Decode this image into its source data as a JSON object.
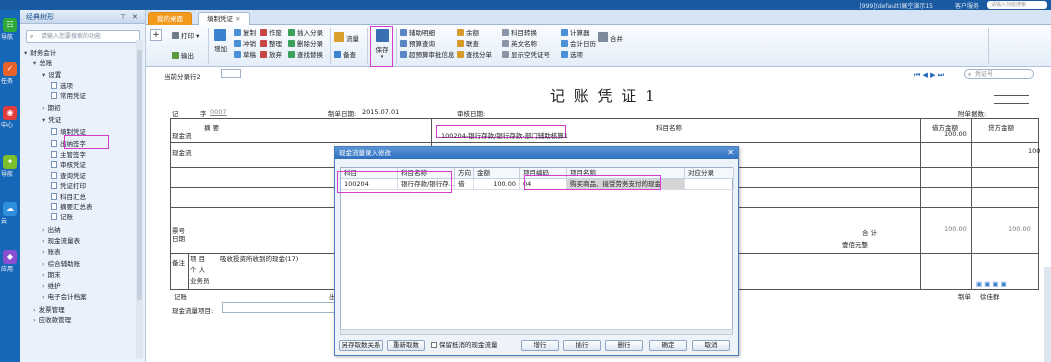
{
  "topbar": {
    "system": "[999](default)展空演示15",
    "service": "客户服务",
    "search_placeholder": "请输入功能搜索"
  },
  "rail": [
    "导航",
    "任务",
    "中心",
    "导航",
    "云",
    "应用"
  ],
  "left_panel": {
    "title": "经典树形",
    "search_placeholder": "请输入您要搜索的功能",
    "tree": [
      {
        "label": "财务会计",
        "level": 0,
        "arrow": "▾"
      },
      {
        "label": "总账",
        "level": 1,
        "arrow": "▾"
      },
      {
        "label": "设置",
        "level": 2,
        "arrow": "▾"
      },
      {
        "label": "选项",
        "level": 3,
        "arrow": ""
      },
      {
        "label": "常用凭证",
        "level": 3,
        "arrow": ""
      },
      {
        "label": "期初",
        "level": 2,
        "arrow": "›"
      },
      {
        "label": "凭证",
        "level": 2,
        "arrow": "▾"
      },
      {
        "label": "填制凭证",
        "level": 3,
        "arrow": ""
      },
      {
        "label": "出纳签字",
        "level": 3,
        "arrow": ""
      },
      {
        "label": "主管签字",
        "level": 3,
        "arrow": ""
      },
      {
        "label": "审核凭证",
        "level": 3,
        "arrow": ""
      },
      {
        "label": "查询凭证",
        "level": 3,
        "arrow": ""
      },
      {
        "label": "凭证打印",
        "level": 3,
        "arrow": ""
      },
      {
        "label": "科目汇总",
        "level": 3,
        "arrow": ""
      },
      {
        "label": "摘要汇总表",
        "level": 3,
        "arrow": ""
      },
      {
        "label": "记账",
        "level": 3,
        "arrow": ""
      },
      {
        "label": "出纳",
        "level": 2,
        "arrow": "›"
      },
      {
        "label": "现金流量表",
        "level": 2,
        "arrow": "›"
      },
      {
        "label": "账表",
        "level": 2,
        "arrow": "›"
      },
      {
        "label": "综合辅助账",
        "level": 2,
        "arrow": "›"
      },
      {
        "label": "期末",
        "level": 2,
        "arrow": "›"
      },
      {
        "label": "维护",
        "level": 2,
        "arrow": "›"
      },
      {
        "label": "电子会计档案",
        "level": 2,
        "arrow": "›"
      },
      {
        "label": "发票管理",
        "level": 1,
        "arrow": "›"
      },
      {
        "label": "应收款管理",
        "level": 1,
        "arrow": "›"
      }
    ]
  },
  "tabs": [
    {
      "label": "我的桌面"
    },
    {
      "label": "填制凭证"
    }
  ],
  "ribbon": {
    "print": "打印",
    "export": "输出",
    "add": "增加",
    "group1": [
      "复制",
      "冲销",
      "草稿"
    ],
    "group2": [
      "作废",
      "整理",
      "放弃"
    ],
    "group3": [
      "插入分录",
      "删除分录",
      "查找替换"
    ],
    "flow": "流量",
    "memo": "备查",
    "save": "保存",
    "group4": [
      "辅助明细",
      "预算查询",
      "超预算审批信息"
    ],
    "group5": [
      "余额",
      "联查",
      "查找分单"
    ],
    "group6": [
      "科目转换",
      "英文名称",
      "显示空凭证号"
    ],
    "group7": [
      "计算器",
      "会计日历",
      "选项"
    ],
    "merge": "合并"
  },
  "form": {
    "entry_row_label": "当前分录行2",
    "voucher_title": "记 账 凭 证 1",
    "voucher_type": "记",
    "voucher_no_label": "字",
    "voucher_no": "0007",
    "date_label": "制单日期:",
    "date": "2015.07.01",
    "audit_label": "审核日期:",
    "attach_label": "附单据数:",
    "nav_search": "凭证号",
    "col_summary": "摘 要",
    "col_account": "科目名称",
    "col_debit": "借方金额",
    "col_credit": "贷方金额",
    "rows": [
      {
        "summary": "现金流",
        "account": "100204-银行存款/银行存款-部门辅助核算1",
        "debit": "100.00",
        "credit": ""
      },
      {
        "summary": "现金流",
        "account": "",
        "debit": "",
        "credit": "100"
      }
    ],
    "ticket_label": "票号",
    "date2_label": "日期",
    "total_label": "合 计",
    "total_debit": "100.00",
    "total_credit": "100.00",
    "amount_words": "壹佰元整",
    "note_label": "备注",
    "note_items": [
      "项 目",
      "个 人",
      "业务员"
    ],
    "note_value": "吸收投资所收到的现金(17)",
    "bookkeeper_label": "记账",
    "cashier_label": "出",
    "maker_label": "制单",
    "maker": "徐佳群",
    "cash_item_label": "现金流量项目:"
  },
  "dialog": {
    "title": "现金流量录入修改",
    "columns": [
      "科目",
      "科目名称",
      "方向",
      "金额",
      "项目编码",
      "项目名称",
      "对应分录"
    ],
    "row": {
      "code": "100204",
      "name": "银行存款/银行存...",
      "dir": "借",
      "amount": "100.00",
      "item_code": "04",
      "item_name": "购买商品、接受劳务支付的现金"
    },
    "buttons": [
      "另存取数关系",
      "重新取数",
      "保留抵消的现金流量",
      "增行",
      "插行",
      "删行",
      "确定",
      "取消"
    ]
  }
}
